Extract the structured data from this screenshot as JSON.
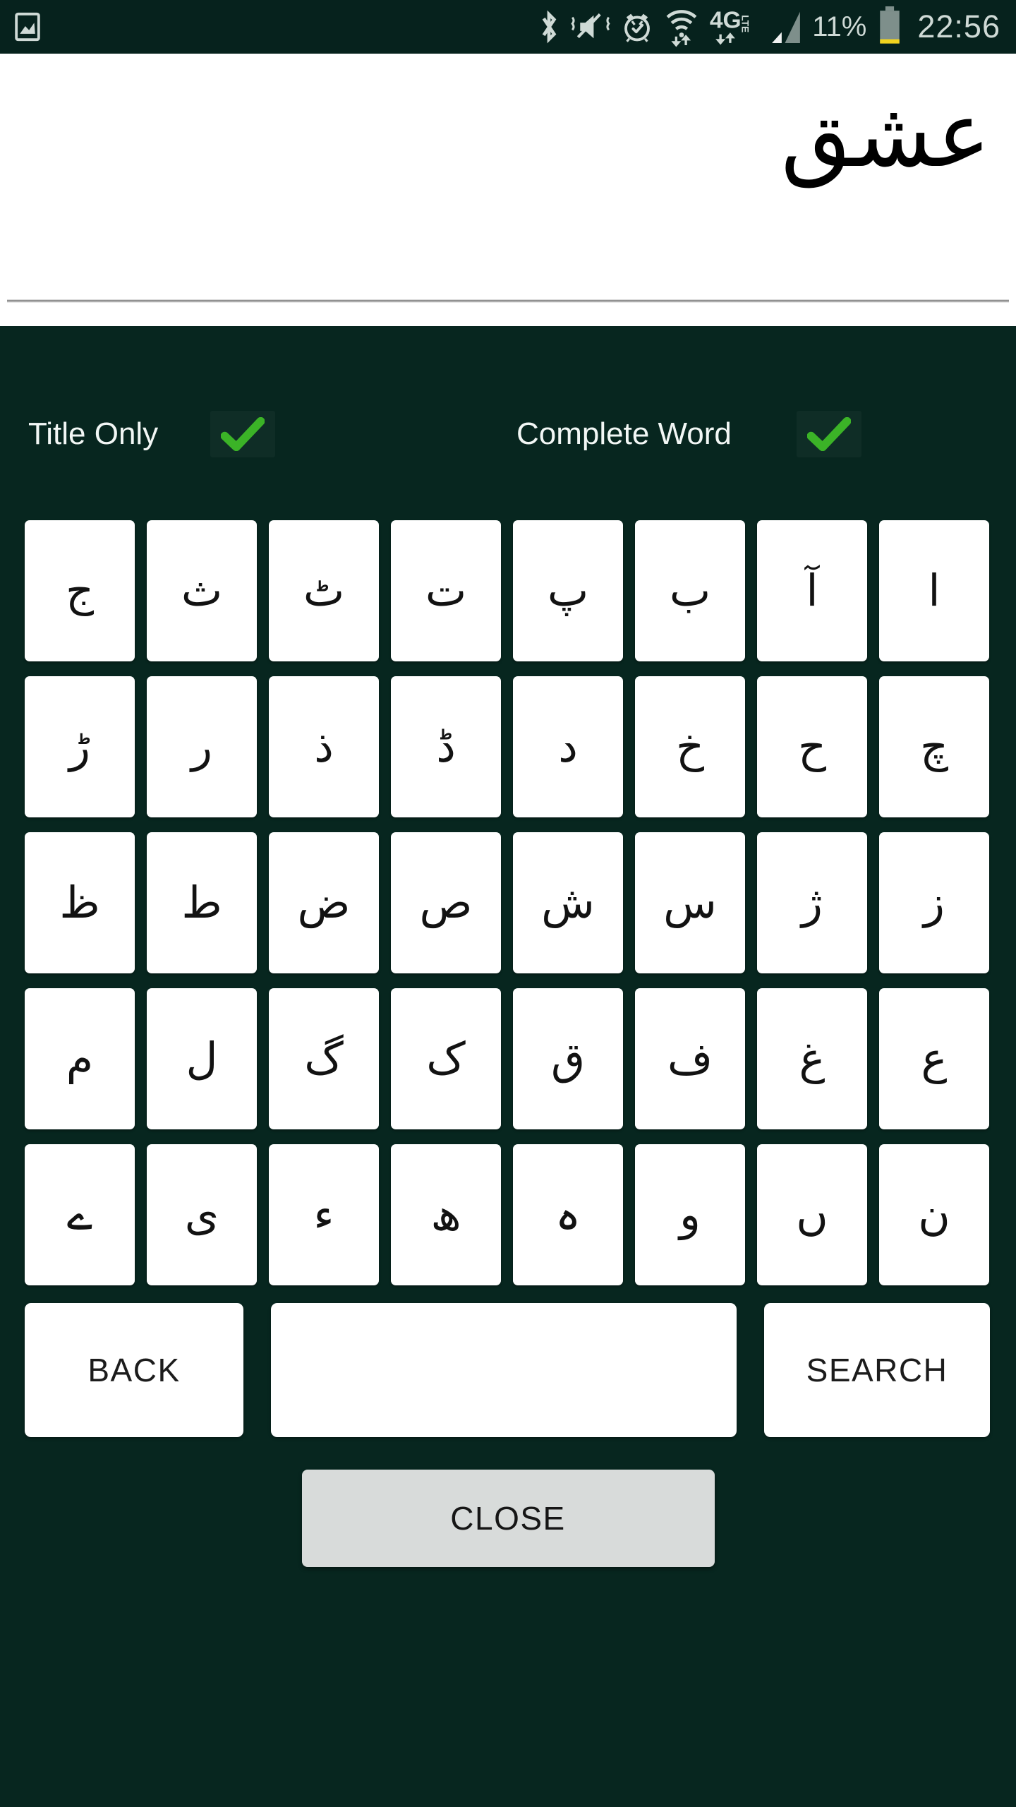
{
  "status_bar": {
    "background_color": "#06221d",
    "foreground_color": "#cfdad6",
    "left_icons": [
      {
        "name": "image-notification-icon",
        "glyph": "picture"
      }
    ],
    "right_icons": [
      {
        "name": "bluetooth-icon",
        "glyph": "bluetooth"
      },
      {
        "name": "mute-vibrate-icon",
        "glyph": "volume-muted"
      },
      {
        "name": "alarm-icon",
        "glyph": "alarm-clock"
      },
      {
        "name": "wifi-icon",
        "glyph": "wifi-with-data-arrows"
      },
      {
        "name": "network-4glte-icon",
        "glyph": "4G LTE"
      },
      {
        "name": "cellular-signal-icon",
        "glyph": "signal-bars"
      }
    ],
    "battery_percent": "11%",
    "battery_level": 11,
    "battery_low_color": "#f2d41f",
    "clock": "22:56"
  },
  "header": {
    "title_word": "عشق",
    "background_color": "#ffffff",
    "text_color": "#000000"
  },
  "panel": {
    "background_color": "#07261f"
  },
  "options": [
    {
      "key": "title_only",
      "label": "Title Only",
      "checked": true,
      "check_color": "#3bb327",
      "check_glyph": "check-mark"
    },
    {
      "key": "complete_word",
      "label": "Complete Word",
      "checked": true,
      "check_color": "#3bb327",
      "check_glyph": "check-mark"
    }
  ],
  "keyboard": {
    "key_background": "#ffffff",
    "key_text_color": "#121212",
    "rows": [
      [
        "ج",
        "ث",
        "ٹ",
        "ت",
        "پ",
        "ب",
        "آ",
        "ا"
      ],
      [
        "ڑ",
        "ر",
        "ذ",
        "ڈ",
        "د",
        "خ",
        "ح",
        "چ"
      ],
      [
        "ظ",
        "ط",
        "ض",
        "ص",
        "ش",
        "س",
        "ژ",
        "ز"
      ],
      [
        "م",
        "ل",
        "گ",
        "ک",
        "ق",
        "ف",
        "غ",
        "ع"
      ],
      [
        "ے",
        "ی",
        "ء",
        "ھ",
        "ہ",
        "و",
        "ں",
        "ن"
      ]
    ]
  },
  "actions": {
    "back_label": "BACK",
    "space_label": "",
    "search_label": "SEARCH"
  },
  "close": {
    "label": "CLOSE",
    "background_color": "#d8dbda",
    "text_color": "#161616"
  }
}
